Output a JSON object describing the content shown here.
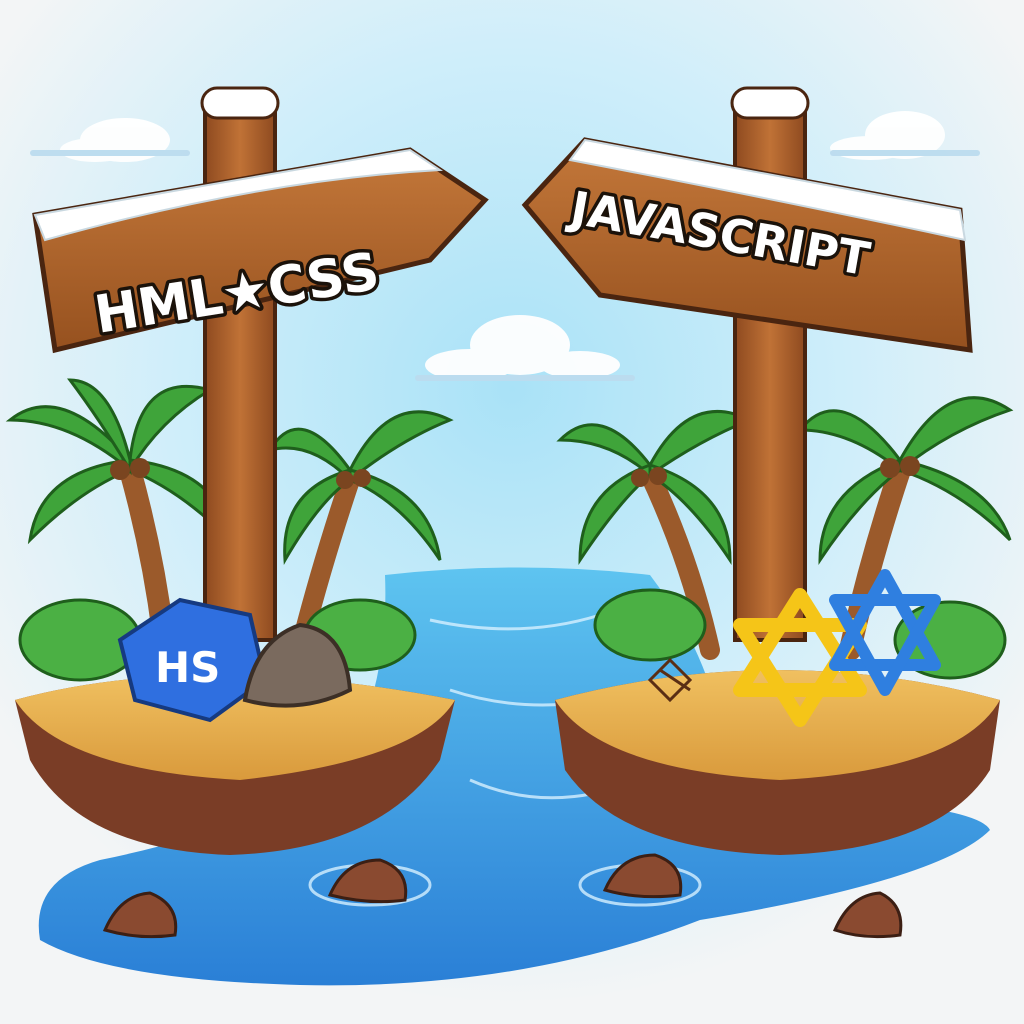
{
  "signs": {
    "left_label": "HML★CSS",
    "right_label": "JAVASCRIPT"
  },
  "badges": {
    "hs_label": "HS"
  },
  "colors": {
    "sky": "#8fd3f2",
    "water": "#2f8fdc",
    "wood": "#b86a31",
    "sand": "#e6b050",
    "cliff": "#7a3d26",
    "leaf": "#3fa43a",
    "snow": "#ffffff",
    "js_logo_yellow": "#f5c518",
    "js_logo_blue": "#2f7fe0",
    "hs_badge": "#2f6fe0"
  },
  "icons": [
    "signpost-icon",
    "palm-tree-icon",
    "hs-badge-icon",
    "star-of-david-logo-icon",
    "rock-icon",
    "cloud-icon"
  ]
}
